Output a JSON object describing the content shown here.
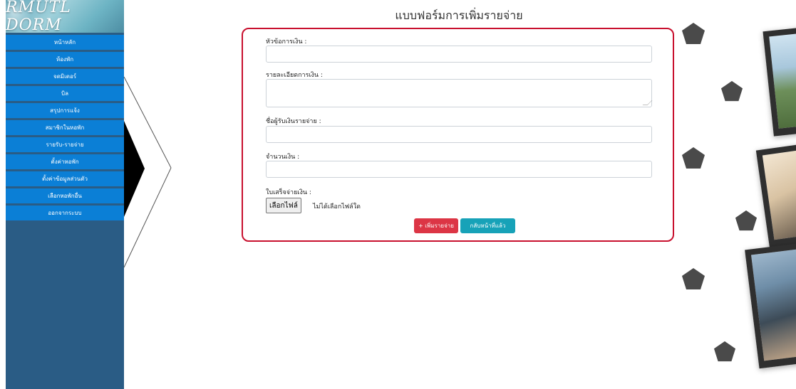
{
  "sidebar": {
    "logo_text": "RMUTL DORM",
    "items": [
      {
        "label": "หน้าหลัก"
      },
      {
        "label": "ห้องพัก"
      },
      {
        "label": "จดมิเตอร์"
      },
      {
        "label": "บิล"
      },
      {
        "label": "สรุปการแจ้ง"
      },
      {
        "label": "สมาชิกในหอพัก"
      },
      {
        "label": "รายรับ-รายจ่าย"
      },
      {
        "label": "ตั้งค่าหอพัก"
      },
      {
        "label": "ตั้งค่าข้อมูลส่วนตัว"
      },
      {
        "label": "เลือกหอพักอื่น"
      },
      {
        "label": "ออกจากระบบ"
      }
    ],
    "colors": {
      "background": "#2a5c85",
      "item": "#0b7fd6"
    }
  },
  "form": {
    "title": "แบบฟอร์มการเพิ่มรายจ่าย",
    "fields": {
      "topic": {
        "label": "หัวข้อการเงิน :",
        "value": ""
      },
      "detail": {
        "label": "รายละเอียดการเงิน :",
        "value": ""
      },
      "recipient": {
        "label": "ชื่อผู้รับเงินรายจ่าย :",
        "value": ""
      },
      "amount": {
        "label": "จำนวนเงิน :",
        "value": ""
      },
      "receipt": {
        "label": "ใบเสร็จจ่ายเงิน :",
        "button": "เลือกไฟล์",
        "status": "ไม่ได้เลือกไฟล์ใด"
      }
    },
    "buttons": {
      "add": "+ เพิ่มรายจ่าย",
      "back": "กลับหน้าที่แล้ว"
    },
    "colors": {
      "border": "#c8102e",
      "add": "#dc3545",
      "back": "#17a2b8"
    }
  }
}
